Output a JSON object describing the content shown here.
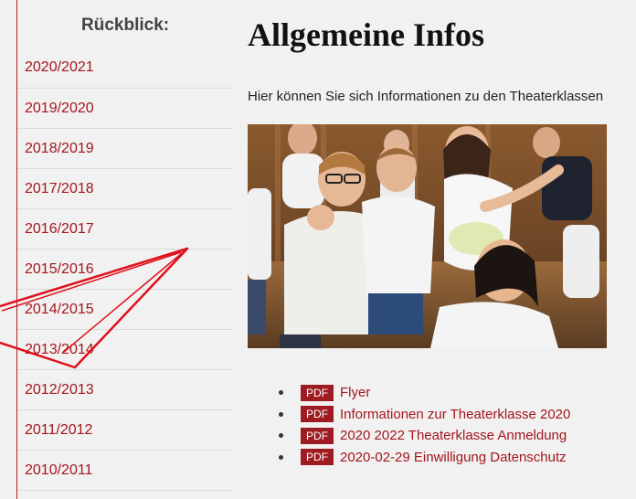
{
  "sidebar": {
    "title": "Rückblick:",
    "years": [
      "2020/2021",
      "2019/2020",
      "2018/2019",
      "2017/2018",
      "2016/2017",
      "2015/2016",
      "2014/2015",
      "2013/2014",
      "2012/2013",
      "2011/2012",
      "2010/2011"
    ]
  },
  "main": {
    "title": "Allgemeine Infos",
    "intro": "Hier können Sie sich Informationen zu den Theaterklassen",
    "documents": [
      {
        "badge": "PDF",
        "label": "Flyer"
      },
      {
        "badge": "PDF",
        "label": "Informationen zur Theaterklasse 2020"
      },
      {
        "badge": "PDF",
        "label": "2020 2022 Theaterklasse Anmeldung"
      },
      {
        "badge": "PDF",
        "label": "2020-02-29 Einwilligung Datenschutz"
      }
    ]
  },
  "colors": {
    "accent": "#a3161d",
    "badge": "#9e1b21",
    "annotation": "#e0101a"
  }
}
